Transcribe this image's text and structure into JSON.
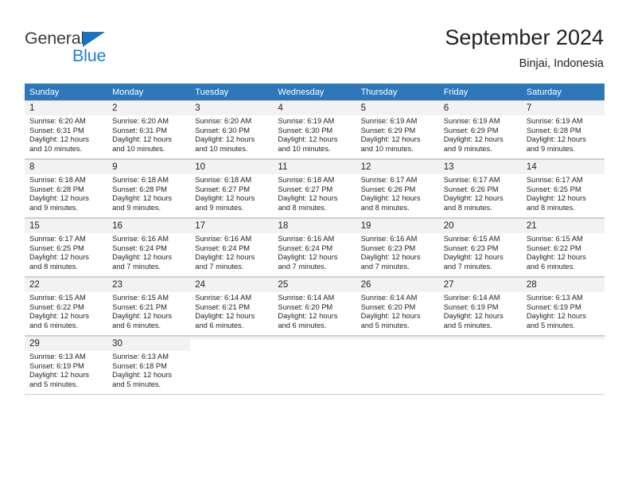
{
  "brand": {
    "name_dark": "General",
    "name_blue": "Blue"
  },
  "header": {
    "title": "September 2024",
    "location": "Binjai, Indonesia"
  },
  "colors": {
    "header_blue": "#2e77b8",
    "brand_blue": "#1b7fd4",
    "logo_triangle": "#1b72bd",
    "text": "#231f20",
    "cell_band": "#f2f2f2",
    "grid_line": "#cfcfcf"
  },
  "weekday_headers": [
    "Sunday",
    "Monday",
    "Tuesday",
    "Wednesday",
    "Thursday",
    "Friday",
    "Saturday"
  ],
  "weeks": [
    [
      {
        "day": "1",
        "sunrise": "Sunrise: 6:20 AM",
        "sunset": "Sunset: 6:31 PM",
        "daylight1": "Daylight: 12 hours",
        "daylight2": "and 10 minutes."
      },
      {
        "day": "2",
        "sunrise": "Sunrise: 6:20 AM",
        "sunset": "Sunset: 6:31 PM",
        "daylight1": "Daylight: 12 hours",
        "daylight2": "and 10 minutes."
      },
      {
        "day": "3",
        "sunrise": "Sunrise: 6:20 AM",
        "sunset": "Sunset: 6:30 PM",
        "daylight1": "Daylight: 12 hours",
        "daylight2": "and 10 minutes."
      },
      {
        "day": "4",
        "sunrise": "Sunrise: 6:19 AM",
        "sunset": "Sunset: 6:30 PM",
        "daylight1": "Daylight: 12 hours",
        "daylight2": "and 10 minutes."
      },
      {
        "day": "5",
        "sunrise": "Sunrise: 6:19 AM",
        "sunset": "Sunset: 6:29 PM",
        "daylight1": "Daylight: 12 hours",
        "daylight2": "and 10 minutes."
      },
      {
        "day": "6",
        "sunrise": "Sunrise: 6:19 AM",
        "sunset": "Sunset: 6:29 PM",
        "daylight1": "Daylight: 12 hours",
        "daylight2": "and 9 minutes."
      },
      {
        "day": "7",
        "sunrise": "Sunrise: 6:19 AM",
        "sunset": "Sunset: 6:28 PM",
        "daylight1": "Daylight: 12 hours",
        "daylight2": "and 9 minutes."
      }
    ],
    [
      {
        "day": "8",
        "sunrise": "Sunrise: 6:18 AM",
        "sunset": "Sunset: 6:28 PM",
        "daylight1": "Daylight: 12 hours",
        "daylight2": "and 9 minutes."
      },
      {
        "day": "9",
        "sunrise": "Sunrise: 6:18 AM",
        "sunset": "Sunset: 6:28 PM",
        "daylight1": "Daylight: 12 hours",
        "daylight2": "and 9 minutes."
      },
      {
        "day": "10",
        "sunrise": "Sunrise: 6:18 AM",
        "sunset": "Sunset: 6:27 PM",
        "daylight1": "Daylight: 12 hours",
        "daylight2": "and 9 minutes."
      },
      {
        "day": "11",
        "sunrise": "Sunrise: 6:18 AM",
        "sunset": "Sunset: 6:27 PM",
        "daylight1": "Daylight: 12 hours",
        "daylight2": "and 8 minutes."
      },
      {
        "day": "12",
        "sunrise": "Sunrise: 6:17 AM",
        "sunset": "Sunset: 6:26 PM",
        "daylight1": "Daylight: 12 hours",
        "daylight2": "and 8 minutes."
      },
      {
        "day": "13",
        "sunrise": "Sunrise: 6:17 AM",
        "sunset": "Sunset: 6:26 PM",
        "daylight1": "Daylight: 12 hours",
        "daylight2": "and 8 minutes."
      },
      {
        "day": "14",
        "sunrise": "Sunrise: 6:17 AM",
        "sunset": "Sunset: 6:25 PM",
        "daylight1": "Daylight: 12 hours",
        "daylight2": "and 8 minutes."
      }
    ],
    [
      {
        "day": "15",
        "sunrise": "Sunrise: 6:17 AM",
        "sunset": "Sunset: 6:25 PM",
        "daylight1": "Daylight: 12 hours",
        "daylight2": "and 8 minutes."
      },
      {
        "day": "16",
        "sunrise": "Sunrise: 6:16 AM",
        "sunset": "Sunset: 6:24 PM",
        "daylight1": "Daylight: 12 hours",
        "daylight2": "and 7 minutes."
      },
      {
        "day": "17",
        "sunrise": "Sunrise: 6:16 AM",
        "sunset": "Sunset: 6:24 PM",
        "daylight1": "Daylight: 12 hours",
        "daylight2": "and 7 minutes."
      },
      {
        "day": "18",
        "sunrise": "Sunrise: 6:16 AM",
        "sunset": "Sunset: 6:24 PM",
        "daylight1": "Daylight: 12 hours",
        "daylight2": "and 7 minutes."
      },
      {
        "day": "19",
        "sunrise": "Sunrise: 6:16 AM",
        "sunset": "Sunset: 6:23 PM",
        "daylight1": "Daylight: 12 hours",
        "daylight2": "and 7 minutes."
      },
      {
        "day": "20",
        "sunrise": "Sunrise: 6:15 AM",
        "sunset": "Sunset: 6:23 PM",
        "daylight1": "Daylight: 12 hours",
        "daylight2": "and 7 minutes."
      },
      {
        "day": "21",
        "sunrise": "Sunrise: 6:15 AM",
        "sunset": "Sunset: 6:22 PM",
        "daylight1": "Daylight: 12 hours",
        "daylight2": "and 6 minutes."
      }
    ],
    [
      {
        "day": "22",
        "sunrise": "Sunrise: 6:15 AM",
        "sunset": "Sunset: 6:22 PM",
        "daylight1": "Daylight: 12 hours",
        "daylight2": "and 6 minutes."
      },
      {
        "day": "23",
        "sunrise": "Sunrise: 6:15 AM",
        "sunset": "Sunset: 6:21 PM",
        "daylight1": "Daylight: 12 hours",
        "daylight2": "and 6 minutes."
      },
      {
        "day": "24",
        "sunrise": "Sunrise: 6:14 AM",
        "sunset": "Sunset: 6:21 PM",
        "daylight1": "Daylight: 12 hours",
        "daylight2": "and 6 minutes."
      },
      {
        "day": "25",
        "sunrise": "Sunrise: 6:14 AM",
        "sunset": "Sunset: 6:20 PM",
        "daylight1": "Daylight: 12 hours",
        "daylight2": "and 6 minutes."
      },
      {
        "day": "26",
        "sunrise": "Sunrise: 6:14 AM",
        "sunset": "Sunset: 6:20 PM",
        "daylight1": "Daylight: 12 hours",
        "daylight2": "and 5 minutes."
      },
      {
        "day": "27",
        "sunrise": "Sunrise: 6:14 AM",
        "sunset": "Sunset: 6:19 PM",
        "daylight1": "Daylight: 12 hours",
        "daylight2": "and 5 minutes."
      },
      {
        "day": "28",
        "sunrise": "Sunrise: 6:13 AM",
        "sunset": "Sunset: 6:19 PM",
        "daylight1": "Daylight: 12 hours",
        "daylight2": "and 5 minutes."
      }
    ],
    [
      {
        "day": "29",
        "sunrise": "Sunrise: 6:13 AM",
        "sunset": "Sunset: 6:19 PM",
        "daylight1": "Daylight: 12 hours",
        "daylight2": "and 5 minutes."
      },
      {
        "day": "30",
        "sunrise": "Sunrise: 6:13 AM",
        "sunset": "Sunset: 6:18 PM",
        "daylight1": "Daylight: 12 hours",
        "daylight2": "and 5 minutes."
      },
      {
        "day": "",
        "sunrise": "",
        "sunset": "",
        "daylight1": "",
        "daylight2": ""
      },
      {
        "day": "",
        "sunrise": "",
        "sunset": "",
        "daylight1": "",
        "daylight2": ""
      },
      {
        "day": "",
        "sunrise": "",
        "sunset": "",
        "daylight1": "",
        "daylight2": ""
      },
      {
        "day": "",
        "sunrise": "",
        "sunset": "",
        "daylight1": "",
        "daylight2": ""
      },
      {
        "day": "",
        "sunrise": "",
        "sunset": "",
        "daylight1": "",
        "daylight2": ""
      }
    ]
  ]
}
